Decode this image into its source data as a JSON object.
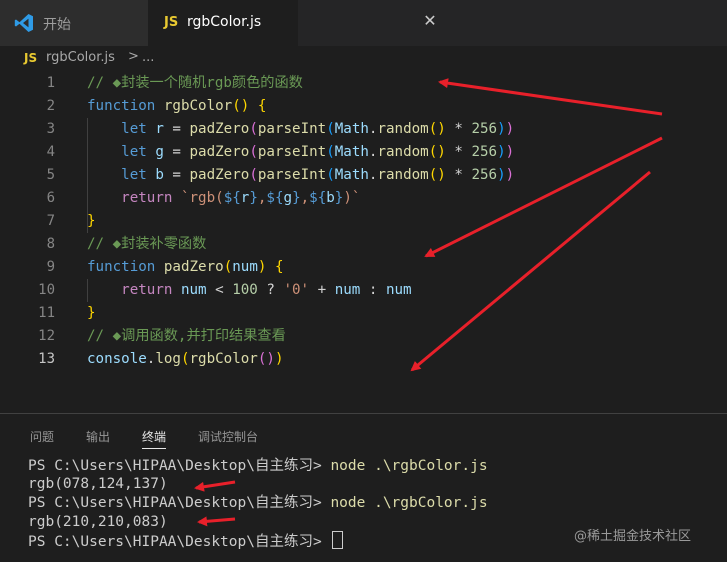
{
  "tabs": {
    "start_label": "开始",
    "file_badge": "JS",
    "file_label": "rgbColor.js",
    "close_glyph": "✕"
  },
  "breadcrumb": {
    "badge": "JS",
    "file": "rgbColor.js",
    "separator": ">",
    "tail": "..."
  },
  "editor": {
    "line_numbers": [
      "1",
      "2",
      "3",
      "4",
      "5",
      "6",
      "7",
      "8",
      "9",
      "10",
      "11",
      "12",
      "13"
    ],
    "active_line": "13"
  },
  "panel": {
    "tabs": [
      "问题",
      "输出",
      "终端",
      "调试控制台"
    ],
    "active_tab": "终端",
    "terminal": [
      {
        "prompt": "PS C:\\Users\\HIPAA\\Desktop\\自主练习> ",
        "cmd": "node .\\rgbColor.js"
      },
      {
        "output": "rgb(078,124,137)"
      },
      {
        "prompt": "PS C:\\Users\\HIPAA\\Desktop\\自主练习> ",
        "cmd": "node .\\rgbColor.js"
      },
      {
        "output": "rgb(210,210,083)"
      },
      {
        "prompt": "PS C:\\Users\\HIPAA\\Desktop\\自主练习> "
      }
    ]
  },
  "watermark": "@稀土掘金技术社区",
  "colors": {
    "arrow": "#e8202a",
    "comment": "#6a9955",
    "keyword": "#569cd6",
    "function": "#dcdcaa"
  },
  "icons": {
    "app": "vscode-icon",
    "close": "close-icon"
  }
}
